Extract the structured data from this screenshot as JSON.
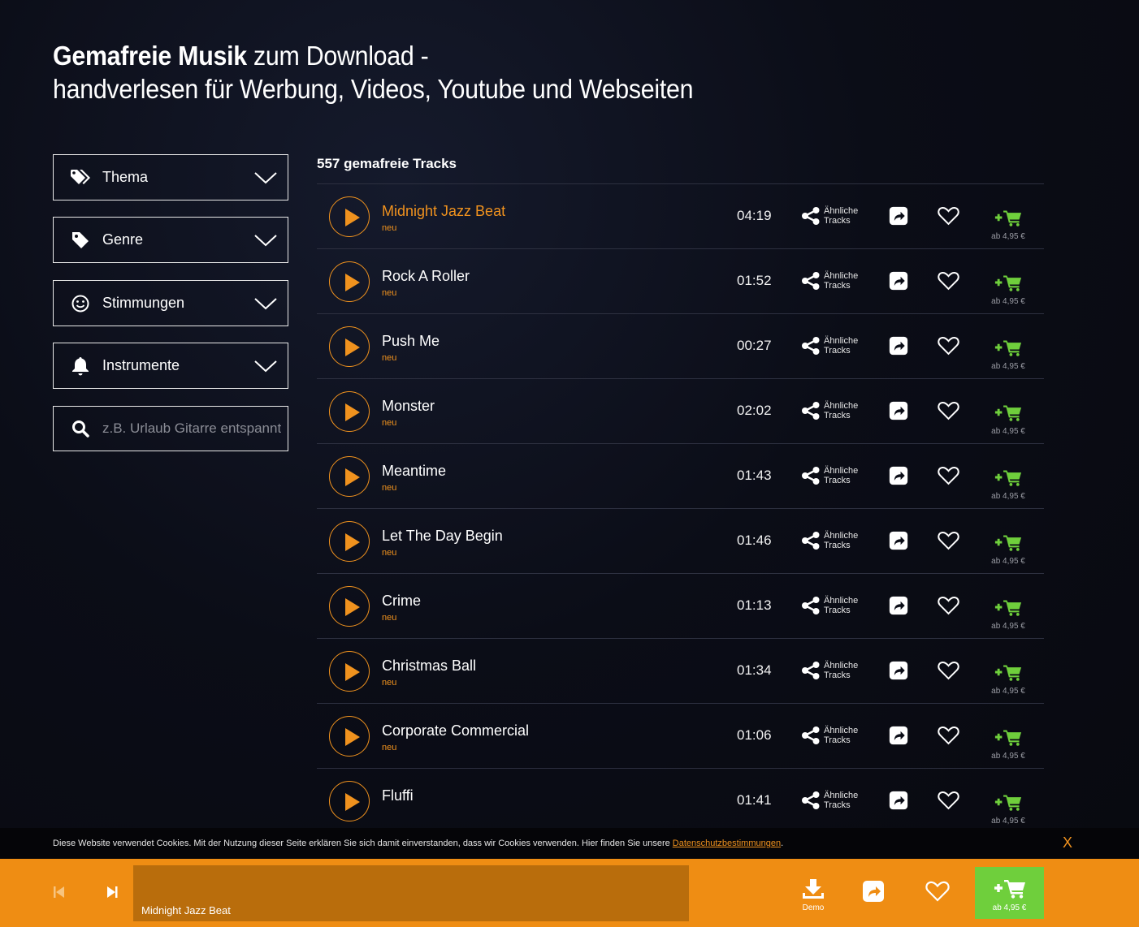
{
  "header": {
    "title_bold": "Gemafreie Musik",
    "title_rest": " zum Download -",
    "subtitle": "handverlesen für Werbung, Videos, Youtube und Webseiten"
  },
  "filters": [
    {
      "label": "Thema",
      "icon": "tags-icon"
    },
    {
      "label": "Genre",
      "icon": "tag-icon"
    },
    {
      "label": "Stimmungen",
      "icon": "smiley-icon"
    },
    {
      "label": "Instrumente",
      "icon": "bell-icon"
    }
  ],
  "search": {
    "placeholder": "z.B. Urlaub Gitarre entspannt"
  },
  "list": {
    "count_label": "557 gemafreie Tracks"
  },
  "track_labels": {
    "new_badge": "neu",
    "similar_line1": "Ähnliche",
    "similar_line2": "Tracks",
    "price": "ab 4,95 €"
  },
  "tracks": [
    {
      "title": "Midnight Jazz Beat",
      "duration": "04:19",
      "new": true,
      "active": true
    },
    {
      "title": "Rock A Roller",
      "duration": "01:52",
      "new": true,
      "active": false
    },
    {
      "title": "Push Me",
      "duration": "00:27",
      "new": true,
      "active": false
    },
    {
      "title": "Monster",
      "duration": "02:02",
      "new": true,
      "active": false
    },
    {
      "title": "Meantime",
      "duration": "01:43",
      "new": true,
      "active": false
    },
    {
      "title": "Let The Day Begin",
      "duration": "01:46",
      "new": true,
      "active": false
    },
    {
      "title": "Crime",
      "duration": "01:13",
      "new": true,
      "active": false
    },
    {
      "title": "Christmas Ball",
      "duration": "01:34",
      "new": true,
      "active": false
    },
    {
      "title": "Corporate Commercial",
      "duration": "01:06",
      "new": true,
      "active": false
    },
    {
      "title": "Fluffi",
      "duration": "01:41",
      "new": false,
      "active": false
    }
  ],
  "cookie": {
    "text": "Diese Website verwendet Cookies. Mit der Nutzung dieser Seite erklären Sie sich damit einverstanden, dass wir Cookies verwenden. Hier finden Sie unsere",
    "link": "Datenschutzbestimmungen",
    "end": ".",
    "close": "X"
  },
  "player": {
    "current_title": "Midnight Jazz Beat",
    "demo_label": "Demo",
    "price": "ab 4,95 €"
  },
  "colors": {
    "accent": "#f0921e",
    "cart_green": "#6fcf3c",
    "player_bg": "#ef8d13",
    "waveform_bg": "#b96d0c"
  }
}
